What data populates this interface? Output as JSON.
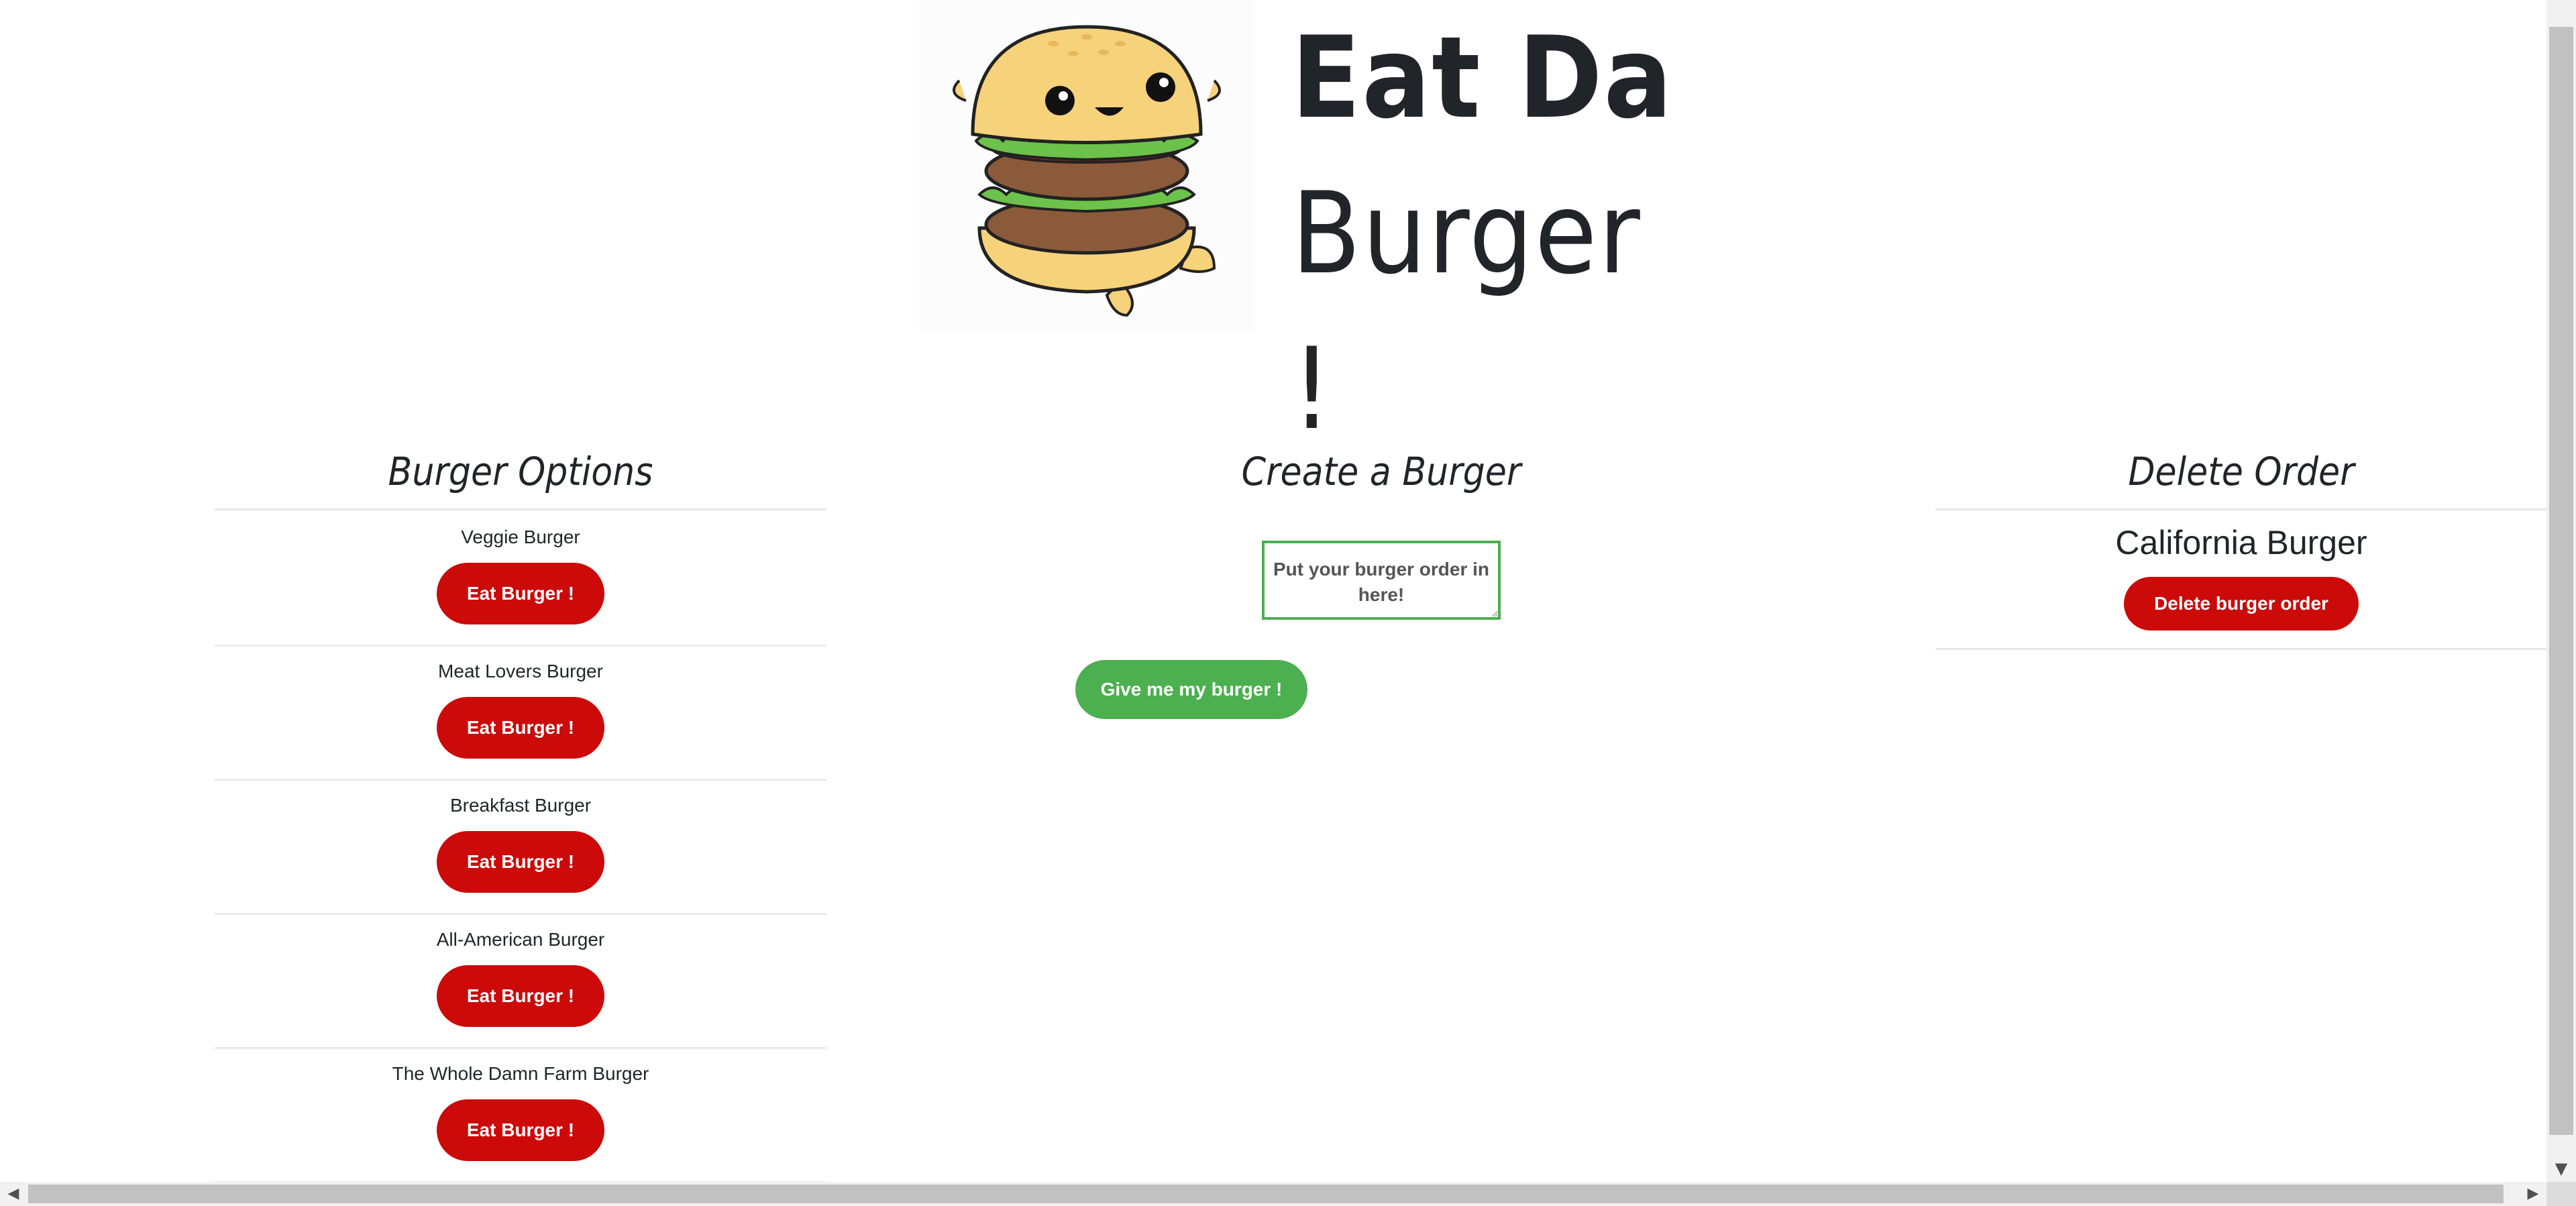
{
  "header": {
    "title_line1": "Eat Da",
    "title_line2": "Burger !",
    "logo_icon": "burger-mascot-icon"
  },
  "options": {
    "heading": "Burger Options",
    "items": [
      {
        "name": "Veggie Burger",
        "button": "Eat Burger !"
      },
      {
        "name": "Meat Lovers Burger",
        "button": "Eat Burger !"
      },
      {
        "name": "Breakfast Burger",
        "button": "Eat Burger !"
      },
      {
        "name": "All-American Burger",
        "button": "Eat Burger !"
      },
      {
        "name": "The Whole Damn Farm Burger",
        "button": "Eat Burger !"
      }
    ]
  },
  "create": {
    "heading": "Create a Burger",
    "placeholder": "Put your burger order in here!",
    "submit_label": "Give me my burger !"
  },
  "delete": {
    "heading": "Delete Order",
    "item_name": "California Burger",
    "button": "Delete burger order"
  },
  "colors": {
    "primary_red": "#cc0a0a",
    "primary_green": "#4caf50"
  }
}
